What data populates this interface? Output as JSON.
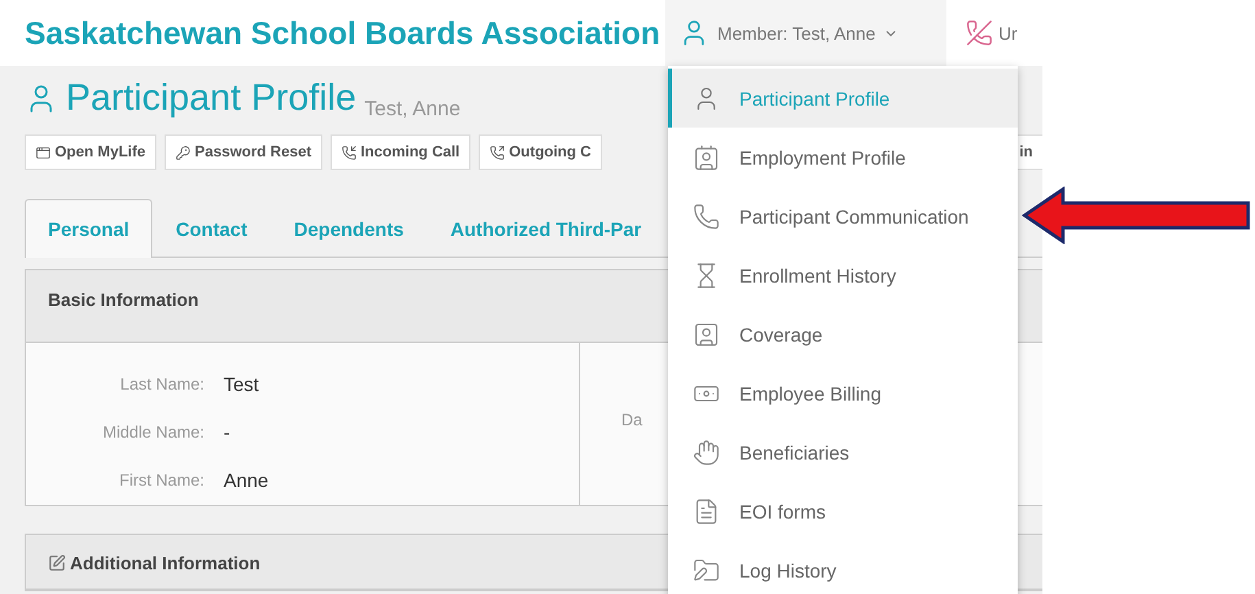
{
  "header": {
    "title": "Saskatchewan School Boards Association",
    "member_menu": {
      "label": "Member: Test, Anne",
      "expanded": true
    },
    "next_item": {
      "label": "Ur"
    }
  },
  "page": {
    "title": "Participant Profile",
    "subtitle": "Test, Anne"
  },
  "toolbar": [
    "Open MyLife",
    "Password Reset",
    "Incoming Call",
    "Outgoing C",
    "in"
  ],
  "tabs": [
    {
      "label": "Personal",
      "selected": true
    },
    {
      "label": "Contact",
      "selected": false
    },
    {
      "label": "Dependents",
      "selected": false
    },
    {
      "label": "Authorized Third-Par",
      "selected": false
    }
  ],
  "basic_information": {
    "title": "Basic Information",
    "fields": [
      {
        "label": "Last Name:",
        "value": "Test"
      },
      {
        "label": "Middle Name:",
        "value": "-"
      },
      {
        "label": "First Name:",
        "value": "Anne"
      }
    ],
    "right_column_label": "Da"
  },
  "additional_information": {
    "title": "Additional Information"
  },
  "menu": [
    {
      "label": "Participant Profile",
      "selected": true
    },
    {
      "label": "Employment Profile",
      "selected": false
    },
    {
      "label": "Participant Communication",
      "selected": false
    },
    {
      "label": "Enrollment History",
      "selected": false
    },
    {
      "label": "Coverage",
      "selected": false
    },
    {
      "label": "Employee Billing",
      "selected": false
    },
    {
      "label": "Beneficiaries",
      "selected": false
    },
    {
      "label": "EOI forms",
      "selected": false
    },
    {
      "label": "Log History",
      "selected": false
    }
  ]
}
